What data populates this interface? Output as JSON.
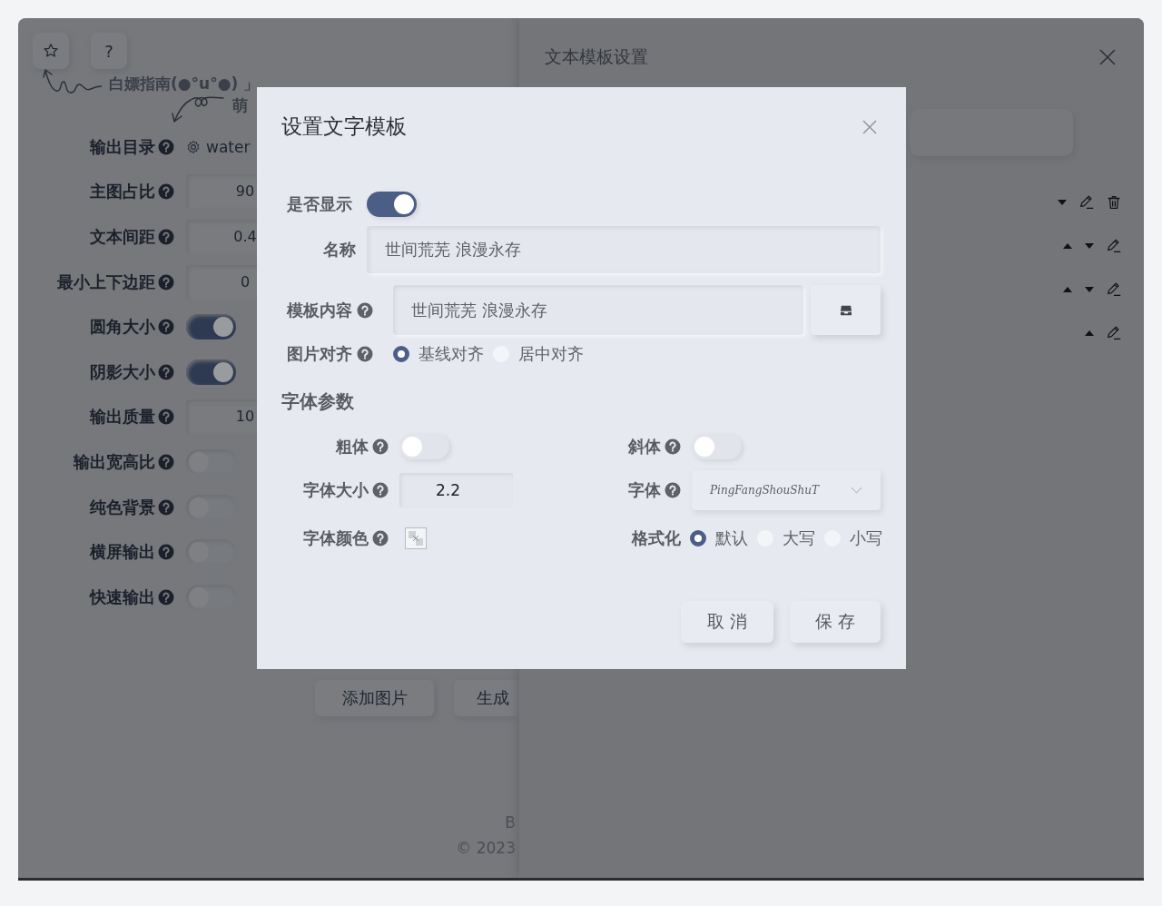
{
  "left": {
    "toolbar": [
      {
        "kind": "icon"
      },
      {
        "kind": "text",
        "label": "?"
      }
    ],
    "hint": {
      "guide": "白嫖指南(●°u°●) 」",
      "newbie": "萌"
    },
    "settings": [
      {
        "label": "输出目录",
        "kind": "folder",
        "value": "water"
      },
      {
        "label": "主图占比",
        "kind": "number",
        "value": "90"
      },
      {
        "label": "文本间距",
        "kind": "number",
        "value": "0.4"
      },
      {
        "label": "最小上下边距",
        "kind": "number",
        "value": "0"
      },
      {
        "label": "圆角大小",
        "kind": "toggle",
        "on": true
      },
      {
        "label": "阴影大小",
        "kind": "toggle",
        "on": true
      },
      {
        "label": "输出质量",
        "kind": "number",
        "value": "10"
      },
      {
        "label": "输出宽高比",
        "kind": "toggle",
        "on": false
      },
      {
        "label": "纯色背景",
        "kind": "toggle",
        "on": false
      },
      {
        "label": "横屏输出",
        "kind": "toggle",
        "on": false
      },
      {
        "label": "快速输出",
        "kind": "toggle",
        "on": false
      }
    ],
    "actions": [
      "添加图片",
      "生成"
    ],
    "footer": [
      "B",
      "© 2023"
    ]
  },
  "drawer": {
    "title": "文本模板设置",
    "templates": [
      {
        "move_up": false,
        "move_down": true,
        "deletable": true
      },
      {
        "move_up": true,
        "move_down": true,
        "deletable": false
      },
      {
        "move_up": true,
        "move_down": true,
        "deletable": false
      },
      {
        "move_up": true,
        "move_down": false,
        "deletable": false
      }
    ]
  },
  "dialog": {
    "title": "设置文字模板",
    "visible": {
      "label": "是否显示",
      "on": true
    },
    "name": {
      "label": "名称",
      "value": "世间荒芜 浪漫永存"
    },
    "content": {
      "label": "模板内容",
      "value": "世间荒芜 浪漫永存"
    },
    "image_align": {
      "label": "图片对齐",
      "options": [
        {
          "label": "基线对齐",
          "selected": true
        },
        {
          "label": "居中对齐",
          "selected": false
        }
      ]
    },
    "font_section": "字体参数",
    "bold": {
      "label": "粗体",
      "on": false
    },
    "italic": {
      "label": "斜体",
      "on": false
    },
    "font_size": {
      "label": "字体大小",
      "value": "2.2"
    },
    "font": {
      "label": "字体",
      "value": "PingFangShouShuT"
    },
    "font_color": {
      "label": "字体颜色"
    },
    "format": {
      "label": "格式化",
      "options": [
        {
          "label": "默认",
          "selected": true
        },
        {
          "label": "大写",
          "selected": false
        },
        {
          "label": "小写",
          "selected": false
        }
      ]
    },
    "buttons": [
      "取 消",
      "保 存"
    ]
  }
}
